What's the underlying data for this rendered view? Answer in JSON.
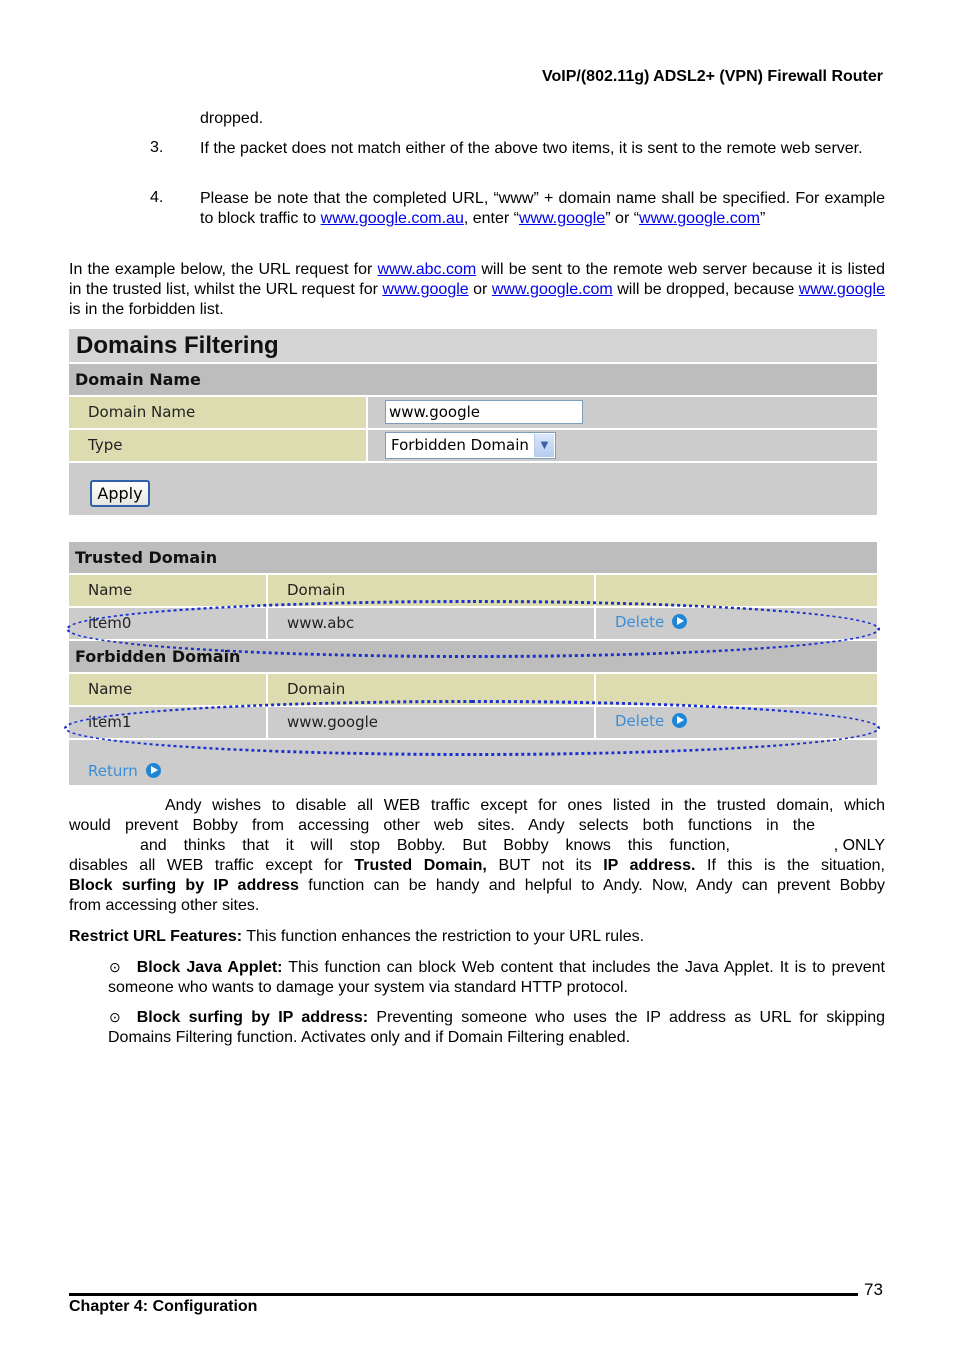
{
  "header": {
    "title": "VoIP/(802.11g) ADSL2+ (VPN) Firewall Router"
  },
  "intro": {
    "dropped": "dropped.",
    "item3": {
      "num": "3.",
      "text": "If the packet does not match either of the above two items, it is sent to the remote web server."
    },
    "item4": {
      "num": "4.",
      "text_a": "Please be note that the completed URL, “www” + domain name shall be specified. For example to block traffic to ",
      "link1": "www.google.com.au",
      "text_b": ", enter “",
      "link2": "www.google",
      "text_c": "” or “",
      "link3": "www.google.com",
      "text_d": "”"
    },
    "example": {
      "text_a": "In the example below, the URL request for ",
      "link1": "www.abc.com",
      "text_b": " will be sent to the remote web server because it is listed in the trusted list, whilst the URL request for ",
      "link2": "www.google",
      "text_c": " or ",
      "link3": "www.google.com",
      "text_d": " will be dropped, because ",
      "link4": "www.google",
      "text_e": " is in the forbidden list."
    }
  },
  "ui": {
    "title": "Domains Filtering",
    "domain_section": "Domain Name",
    "fields": {
      "domain_name_label": "Domain Name",
      "domain_name_value": "www.google",
      "type_label": "Type",
      "type_value": "Forbidden Domain"
    },
    "apply_label": "Apply",
    "trusted": {
      "title": "Trusted Domain",
      "headers": [
        "Name",
        "Domain",
        ""
      ],
      "rows": [
        {
          "name": "item0",
          "domain": "www.abc",
          "action": "Delete"
        }
      ]
    },
    "forbidden": {
      "title": "Forbidden Domain",
      "headers": [
        "Name",
        "Domain",
        ""
      ],
      "rows": [
        {
          "name": "item1",
          "domain": "www.google",
          "action": "Delete"
        }
      ]
    },
    "return_label": "Return"
  },
  "body": {
    "p1_line1": "Andy wishes to disable all WEB traffic except for ones listed in the trusted domain, which",
    "p1_line2": "would prevent Bobby from accessing other web sites.  Andy selects both functions in the",
    "p1_line3a": "and thinks that it will stop Bobby.  But Bobby knows this function,",
    "p1_line3b": ", ONLY",
    "p1_line4a": "disables all WEB traffic except for ",
    "p1_line4b": "Trusted Domain,",
    "p1_line4c": " BUT not its ",
    "p1_line4d": "IP address.",
    "p1_line4e": "  If this is the situation,",
    "p1_line5a": "Block surfing by IP address",
    "p1_line5b": " function can be handy and helpful to Andy.   Now, Andy can prevent Bobby",
    "p1_line6": "from accessing other sites.",
    "restrict_label": "Restrict URL Features:",
    "restrict_text": " This function enhances the restriction to your URL rules.",
    "bullets": [
      {
        "icon": "⊙",
        "label": "Block Java Applet:",
        "text": " This function can block Web content that includes the Java Applet. It is to prevent someone who wants to damage your system via standard HTTP protocol."
      },
      {
        "icon": "⊙",
        "label": "Block surfing by IP address:",
        "text": " Preventing someone who uses the IP address as URL for skipping Domains Filtering function.   Activates only and if Domain Filtering enabled."
      }
    ]
  },
  "footer": {
    "chapter": "Chapter 4: Configuration",
    "page": "73"
  }
}
